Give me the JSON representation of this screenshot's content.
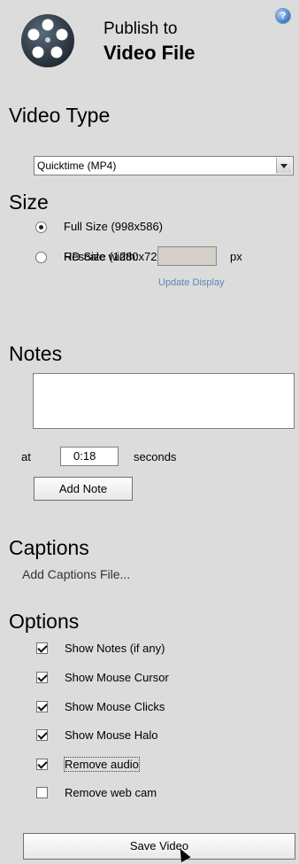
{
  "header": {
    "title_line1": "Publish to",
    "title_line2": "Video File",
    "help_icon": "question-mark-icon",
    "logo_icon": "film-reel-icon"
  },
  "video_type": {
    "title": "Video Type",
    "selected": "Quicktime (MP4)"
  },
  "size": {
    "title": "Size",
    "options": [
      {
        "label": "Full Size (998x586)",
        "checked": true
      },
      {
        "label": "HD Size (1280x720)",
        "checked": false
      },
      {
        "label": "Rescale width:",
        "checked": false
      }
    ],
    "rescale_value": "",
    "unit": "px",
    "update_link": "Update Display"
  },
  "notes": {
    "title": "Notes",
    "text": "",
    "at_label": "at",
    "time_value": "0:18",
    "seconds_label": "seconds",
    "add_button": "Add Note"
  },
  "captions": {
    "title": "Captions",
    "link": "Add Captions File..."
  },
  "options": {
    "title": "Options",
    "items": [
      {
        "label": "Show Notes (if any)",
        "checked": true
      },
      {
        "label": "Show Mouse Cursor",
        "checked": true
      },
      {
        "label": "Show Mouse Clicks",
        "checked": true
      },
      {
        "label": "Show Mouse Halo",
        "checked": true
      },
      {
        "label": "Remove audio",
        "checked": true
      },
      {
        "label": "Remove web cam",
        "checked": false
      }
    ]
  },
  "save_button": "Save Video",
  "colors": {
    "background": "#dcdcdc",
    "link": "#5a86b8"
  }
}
